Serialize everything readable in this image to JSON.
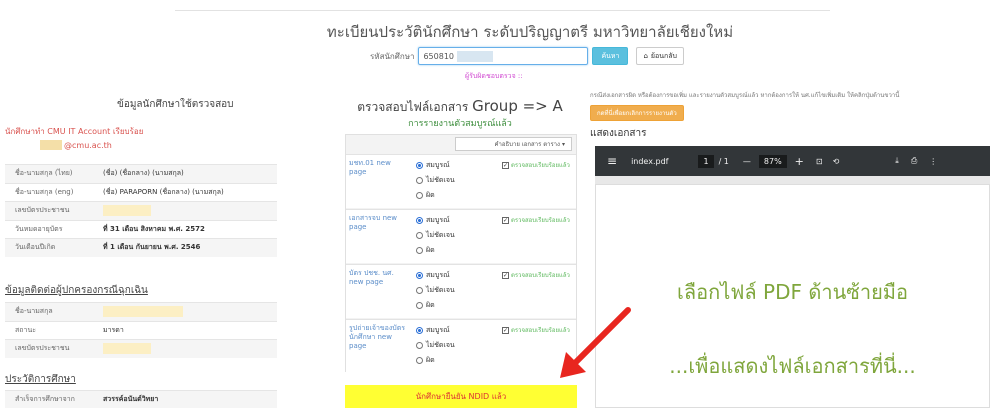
{
  "header": {
    "title": "ทะเบียนประวัตินักศึกษา ระดับปริญญาตรี มหาวิทยาลัยเชียงใหม่",
    "student_id_label": "รหัสนักศึกษา",
    "student_id_value": "650810",
    "search_button": "ค้นหา",
    "home_button": "ย้อนกลับ",
    "checker": "ผู้รับผิดชอบตรวจ ::"
  },
  "student": {
    "heading": "ข้อมูลนักศึกษาใช้ตรวจสอบ",
    "cmu_status": "นักศึกษาทำ CMU IT Account เรียบร้อย",
    "email_suffix": "@cmu.ac.th",
    "rows": [
      {
        "label": "ชื่อ-นามสกุล (ไทย)",
        "value": "(ชื่อ)        (ชื่อกลาง) (นามสกุล)"
      },
      {
        "label": "ชื่อ-นามสกุล (eng)",
        "value": "(ชื่อ) PARAPORN (ชื่อกลาง) (นามสกุล)"
      },
      {
        "label": "เลขบัตรประชาชน",
        "value": ""
      },
      {
        "label": "วันหมดอายุบัตร",
        "value": "ที่ 31 เดือน สิงหาคม พ.ศ. 2572"
      },
      {
        "label": "วันเดือนปีเกิด",
        "value": "ที่ 1 เดือน กันยายน พ.ศ. 2546"
      }
    ]
  },
  "guardian": {
    "heading": "ข้อมูลติดต่อผู้ปกครองกรณีฉุกเฉิน",
    "rows": [
      {
        "label": "ชื่อ-นามสกุล",
        "value": ""
      },
      {
        "label": "สถานะ",
        "value": "มารดา"
      },
      {
        "label": "เลขบัตรประชาชน",
        "value": ""
      }
    ]
  },
  "education": {
    "heading": "ประวัติการศึกษา",
    "rows": [
      {
        "label": "สำเร็จการศึกษาจาก",
        "value": "สวรรค์อนันต์วิทยา"
      }
    ]
  },
  "check": {
    "heading_prefix": "ตรวจสอบไฟล์เอกสาร",
    "heading_group": "Group => A",
    "subheading": "การรายงานตัวสมบูรณ์แล้ว",
    "select_label": "คำอธิบาย เอกสาร ตาราง",
    "documents": [
      {
        "name": "มชท.01 new page",
        "options": [
          "สมบูรณ์",
          "ไม่ชัดเจน",
          "ผิด"
        ],
        "status": "ตรวจสอบเรียบร้อยแล้ว"
      },
      {
        "name": "เอกสารจบ new page",
        "options": [
          "สมบูรณ์",
          "ไม่ชัดเจน",
          "ผิด"
        ],
        "status": "ตรวจสอบเรียบร้อยแล้ว"
      },
      {
        "name": "บัตร ปชช. นศ. new page",
        "options": [
          "สมบูรณ์",
          "ไม่ชัดเจน",
          "ผิด"
        ],
        "status": "ตรวจสอบเรียบร้อยแล้ว"
      },
      {
        "name": "รูปถ่ายเจ้าของบัตร นักศึกษา new page",
        "options": [
          "สมบูรณ์",
          "ไม่ชัดเจน",
          "ผิด"
        ],
        "status": "ตรวจสอบเรียบร้อยแล้ว"
      }
    ],
    "ndid": "นักศึกษายืนยัน NDID แล้ว"
  },
  "viewer": {
    "note": "กรณีส่งเอกสารผิด หรือต้องการขอเพิ่ม และรายงานตัวสมบูรณ์แล้ว หากต้องการให้ นศ.แก้ไขเพิ่มเติม ให้คลิกปุ่มด้านขวานี้",
    "unlock_button": "กดที่นี่เพื่อยกเลิกการรายงานตัว",
    "heading": "แสดงเอกสาร",
    "pdf_name": "index.pdf",
    "page_current": "1",
    "page_total": "/ 1",
    "zoom": "87%",
    "placeholder1": "เลือกไฟล์ PDF ด้านซ้ายมือ",
    "placeholder2": "...เพื่อแสดงไฟล์เอกสารที่นี่..."
  },
  "colors": {
    "accent_green": "#7fa63c",
    "alert_red": "#d9534f",
    "ndid_yellow": "#ffff33"
  }
}
